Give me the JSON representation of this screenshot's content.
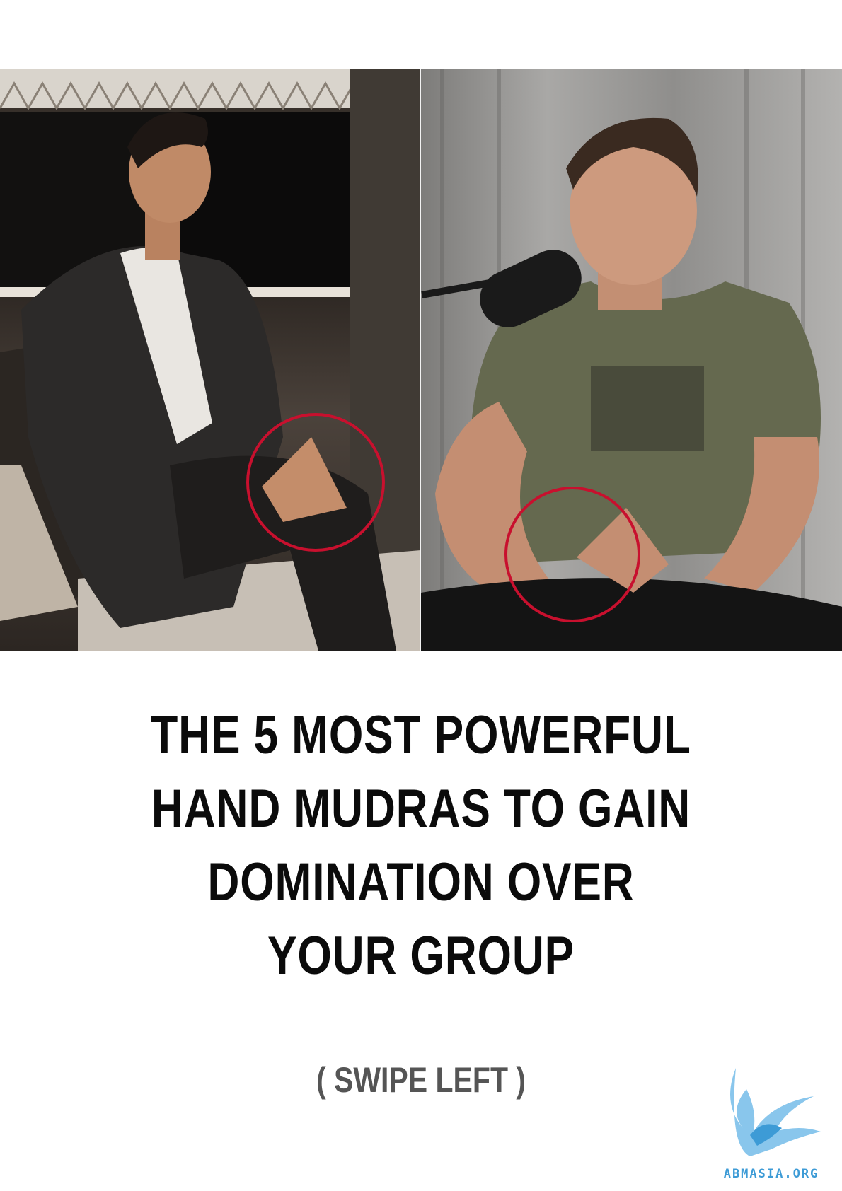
{
  "headline": {
    "lines": [
      "THE 5 MOST POWERFUL",
      "HAND MUDRAS TO GAIN",
      "DOMINATION OVER",
      "YOUR GROUP"
    ]
  },
  "cta": "( SWIPE LEFT )",
  "logo": {
    "text": "ABMASIA.ORG",
    "icon": "winged-griffin-icon"
  },
  "photos": [
    {
      "name": "left-photo",
      "highlight": "red-circle"
    },
    {
      "name": "right-photo",
      "highlight": "red-circle"
    }
  ],
  "colors": {
    "highlight": "#c8102e",
    "headline": "#0b0b0b",
    "cta": "#555555",
    "logo": "#3d9bd6"
  }
}
